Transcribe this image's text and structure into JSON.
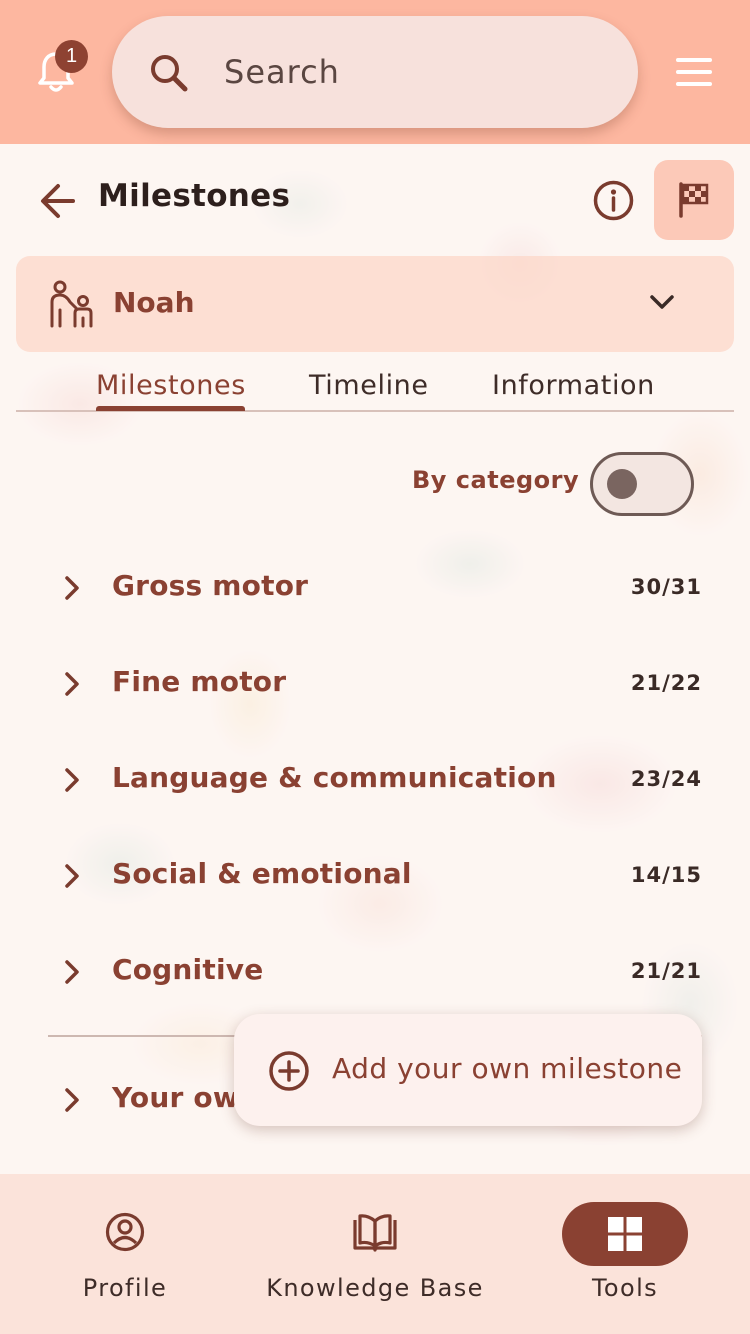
{
  "header": {
    "notification_count": "1",
    "search_placeholder": "Search"
  },
  "page": {
    "title": "Milestones"
  },
  "child": {
    "name": "Noah"
  },
  "tabs": [
    {
      "label": "Milestones",
      "active": true
    },
    {
      "label": "Timeline",
      "active": false
    },
    {
      "label": "Information",
      "active": false
    }
  ],
  "toggle": {
    "label": "By category",
    "on": false
  },
  "categories": [
    {
      "label": "Gross motor",
      "count": "30/31"
    },
    {
      "label": "Fine motor",
      "count": "21/22"
    },
    {
      "label": "Language & communication",
      "count": "23/24"
    },
    {
      "label": "Social & emotional",
      "count": "14/15"
    },
    {
      "label": "Cognitive",
      "count": "21/21"
    },
    {
      "label": "Your own"
    }
  ],
  "add_popup": {
    "label": "Add your own milestone"
  },
  "bottom_nav": [
    {
      "label": "Profile",
      "icon": "profile-icon"
    },
    {
      "label": "Knowledge Base",
      "icon": "book-icon"
    },
    {
      "label": "Tools",
      "icon": "grid-icon",
      "active": true
    }
  ],
  "colors": {
    "accent": "#8a4132",
    "topbar": "#fdb7a0",
    "nav_background": "#fbe3da"
  }
}
